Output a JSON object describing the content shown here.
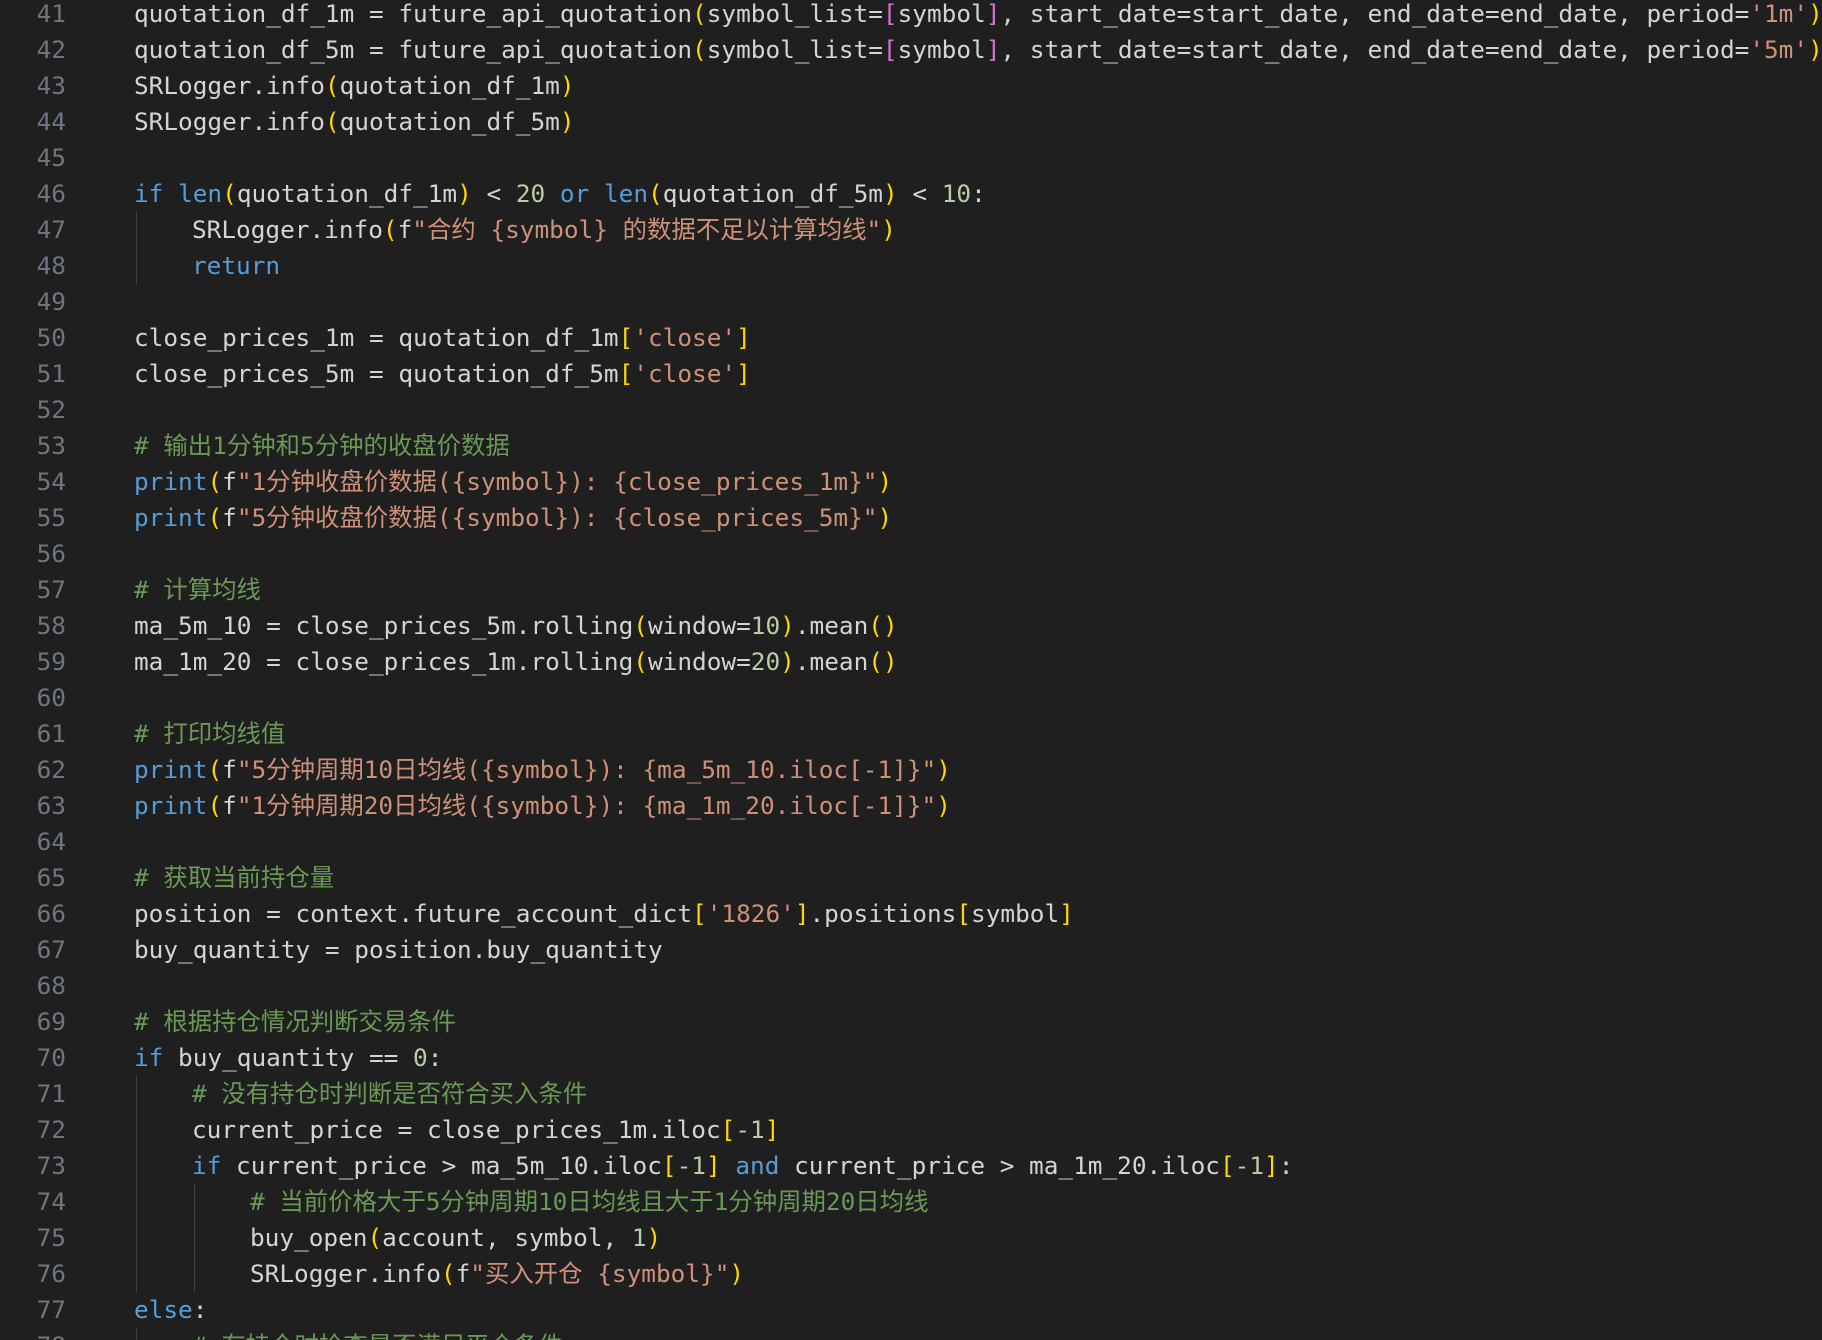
{
  "editor": {
    "language": "python",
    "theme_colors": {
      "background": "#1f1f1f",
      "line_number": "#6e7681",
      "keyword": "#569cd6",
      "string": "#ce9178",
      "number": "#b5cea8",
      "comment": "#6a9955",
      "bracket_level1": "#ffd700",
      "bracket_level2": "#da70d6",
      "plain": "#d4d4d4"
    },
    "lines": [
      {
        "n": "41",
        "indent": 1,
        "tokens": [
          [
            "pl",
            "quotation_df_1m = future_api_quotation"
          ],
          [
            "b1",
            "("
          ],
          [
            "pl",
            "symbol_list="
          ],
          [
            "b2",
            "["
          ],
          [
            "pl",
            "symbol"
          ],
          [
            "b2",
            "]"
          ],
          [
            "pl",
            ", start_date=start_date, end_date=end_date, period="
          ],
          [
            "str",
            "'1m'"
          ],
          [
            "b1",
            ")"
          ]
        ]
      },
      {
        "n": "42",
        "indent": 1,
        "tokens": [
          [
            "pl",
            "quotation_df_5m = future_api_quotation"
          ],
          [
            "b1",
            "("
          ],
          [
            "pl",
            "symbol_list="
          ],
          [
            "b2",
            "["
          ],
          [
            "pl",
            "symbol"
          ],
          [
            "b2",
            "]"
          ],
          [
            "pl",
            ", start_date=start_date, end_date=end_date, period="
          ],
          [
            "str",
            "'5m'"
          ],
          [
            "b1",
            ")"
          ]
        ]
      },
      {
        "n": "43",
        "indent": 1,
        "tokens": [
          [
            "pl",
            "SRLogger.info"
          ],
          [
            "b1",
            "("
          ],
          [
            "pl",
            "quotation_df_1m"
          ],
          [
            "b1",
            ")"
          ]
        ]
      },
      {
        "n": "44",
        "indent": 1,
        "tokens": [
          [
            "pl",
            "SRLogger.info"
          ],
          [
            "b1",
            "("
          ],
          [
            "pl",
            "quotation_df_5m"
          ],
          [
            "b1",
            ")"
          ]
        ]
      },
      {
        "n": "45",
        "indent": 1,
        "tokens": []
      },
      {
        "n": "46",
        "indent": 1,
        "tokens": [
          [
            "kw",
            "if"
          ],
          [
            "pl",
            " "
          ],
          [
            "kw",
            "len"
          ],
          [
            "b1",
            "("
          ],
          [
            "pl",
            "quotation_df_1m"
          ],
          [
            "b1",
            ")"
          ],
          [
            "pl",
            " < "
          ],
          [
            "num",
            "20"
          ],
          [
            "pl",
            " "
          ],
          [
            "kw",
            "or"
          ],
          [
            "pl",
            " "
          ],
          [
            "kw",
            "len"
          ],
          [
            "b1",
            "("
          ],
          [
            "pl",
            "quotation_df_5m"
          ],
          [
            "b1",
            ")"
          ],
          [
            "pl",
            " < "
          ],
          [
            "num",
            "10"
          ],
          [
            "pl",
            ":"
          ]
        ]
      },
      {
        "n": "47",
        "indent": 2,
        "tokens": [
          [
            "pl",
            "SRLogger.info"
          ],
          [
            "b1",
            "("
          ],
          [
            "pl",
            "f"
          ],
          [
            "str",
            "\"合约 {symbol} 的数据不足以计算均线\""
          ],
          [
            "b1",
            ")"
          ]
        ]
      },
      {
        "n": "48",
        "indent": 2,
        "tokens": [
          [
            "kw",
            "return"
          ]
        ]
      },
      {
        "n": "49",
        "indent": 1,
        "tokens": []
      },
      {
        "n": "50",
        "indent": 1,
        "tokens": [
          [
            "pl",
            "close_prices_1m = quotation_df_1m"
          ],
          [
            "b1",
            "["
          ],
          [
            "str",
            "'close'"
          ],
          [
            "b1",
            "]"
          ]
        ]
      },
      {
        "n": "51",
        "indent": 1,
        "tokens": [
          [
            "pl",
            "close_prices_5m = quotation_df_5m"
          ],
          [
            "b1",
            "["
          ],
          [
            "str",
            "'close'"
          ],
          [
            "b1",
            "]"
          ]
        ]
      },
      {
        "n": "52",
        "indent": 1,
        "tokens": []
      },
      {
        "n": "53",
        "indent": 1,
        "tokens": [
          [
            "cm",
            "# 输出1分钟和5分钟的收盘价数据"
          ]
        ]
      },
      {
        "n": "54",
        "indent": 1,
        "tokens": [
          [
            "kw",
            "print"
          ],
          [
            "b1",
            "("
          ],
          [
            "pl",
            "f"
          ],
          [
            "str",
            "\"1分钟收盘价数据({symbol}): {close_prices_1m}\""
          ],
          [
            "b1",
            ")"
          ]
        ]
      },
      {
        "n": "55",
        "indent": 1,
        "tokens": [
          [
            "kw",
            "print"
          ],
          [
            "b1",
            "("
          ],
          [
            "pl",
            "f"
          ],
          [
            "str",
            "\"5分钟收盘价数据({symbol}): {close_prices_5m}\""
          ],
          [
            "b1",
            ")"
          ]
        ]
      },
      {
        "n": "56",
        "indent": 1,
        "tokens": []
      },
      {
        "n": "57",
        "indent": 1,
        "tokens": [
          [
            "cm",
            "# 计算均线"
          ]
        ]
      },
      {
        "n": "58",
        "indent": 1,
        "tokens": [
          [
            "pl",
            "ma_5m_10 = close_prices_5m.rolling"
          ],
          [
            "b1",
            "("
          ],
          [
            "pl",
            "window="
          ],
          [
            "num",
            "10"
          ],
          [
            "b1",
            ")"
          ],
          [
            "pl",
            ".mean"
          ],
          [
            "b1",
            "()"
          ]
        ]
      },
      {
        "n": "59",
        "indent": 1,
        "tokens": [
          [
            "pl",
            "ma_1m_20 = close_prices_1m.rolling"
          ],
          [
            "b1",
            "("
          ],
          [
            "pl",
            "window="
          ],
          [
            "num",
            "20"
          ],
          [
            "b1",
            ")"
          ],
          [
            "pl",
            ".mean"
          ],
          [
            "b1",
            "()"
          ]
        ]
      },
      {
        "n": "60",
        "indent": 1,
        "tokens": []
      },
      {
        "n": "61",
        "indent": 1,
        "tokens": [
          [
            "cm",
            "# 打印均线值"
          ]
        ]
      },
      {
        "n": "62",
        "indent": 1,
        "tokens": [
          [
            "kw",
            "print"
          ],
          [
            "b1",
            "("
          ],
          [
            "pl",
            "f"
          ],
          [
            "str",
            "\"5分钟周期10日均线({symbol}): {ma_5m_10.iloc[-1]}\""
          ],
          [
            "b1",
            ")"
          ]
        ]
      },
      {
        "n": "63",
        "indent": 1,
        "tokens": [
          [
            "kw",
            "print"
          ],
          [
            "b1",
            "("
          ],
          [
            "pl",
            "f"
          ],
          [
            "str",
            "\"1分钟周期20日均线({symbol}): {ma_1m_20.iloc[-1]}\""
          ],
          [
            "b1",
            ")"
          ]
        ]
      },
      {
        "n": "64",
        "indent": 1,
        "tokens": []
      },
      {
        "n": "65",
        "indent": 1,
        "tokens": [
          [
            "cm",
            "# 获取当前持仓量"
          ]
        ]
      },
      {
        "n": "66",
        "indent": 1,
        "tokens": [
          [
            "pl",
            "position = context.future_account_dict"
          ],
          [
            "b1",
            "["
          ],
          [
            "str",
            "'1826'"
          ],
          [
            "b1",
            "]"
          ],
          [
            "pl",
            ".positions"
          ],
          [
            "b1",
            "["
          ],
          [
            "pl",
            "symbol"
          ],
          [
            "b1",
            "]"
          ]
        ]
      },
      {
        "n": "67",
        "indent": 1,
        "tokens": [
          [
            "pl",
            "buy_quantity = position.buy_quantity"
          ]
        ]
      },
      {
        "n": "68",
        "indent": 1,
        "tokens": []
      },
      {
        "n": "69",
        "indent": 1,
        "tokens": [
          [
            "cm",
            "# 根据持仓情况判断交易条件"
          ]
        ]
      },
      {
        "n": "70",
        "indent": 1,
        "tokens": [
          [
            "kw",
            "if"
          ],
          [
            "pl",
            " buy_quantity == "
          ],
          [
            "num",
            "0"
          ],
          [
            "pl",
            ":"
          ]
        ]
      },
      {
        "n": "71",
        "indent": 2,
        "tokens": [
          [
            "cm",
            "# 没有持仓时判断是否符合买入条件"
          ]
        ]
      },
      {
        "n": "72",
        "indent": 2,
        "tokens": [
          [
            "pl",
            "current_price = close_prices_1m.iloc"
          ],
          [
            "b1",
            "["
          ],
          [
            "num",
            "-1"
          ],
          [
            "b1",
            "]"
          ]
        ]
      },
      {
        "n": "73",
        "indent": 2,
        "tokens": [
          [
            "kw",
            "if"
          ],
          [
            "pl",
            " current_price > ma_5m_10.iloc"
          ],
          [
            "b1",
            "["
          ],
          [
            "num",
            "-1"
          ],
          [
            "b1",
            "]"
          ],
          [
            "pl",
            " "
          ],
          [
            "kw",
            "and"
          ],
          [
            "pl",
            " current_price > ma_1m_20.iloc"
          ],
          [
            "b1",
            "["
          ],
          [
            "num",
            "-1"
          ],
          [
            "b1",
            "]"
          ],
          [
            "pl",
            ":"
          ]
        ]
      },
      {
        "n": "74",
        "indent": 3,
        "tokens": [
          [
            "cm",
            "# 当前价格大于5分钟周期10日均线且大于1分钟周期20日均线"
          ]
        ]
      },
      {
        "n": "75",
        "indent": 3,
        "tokens": [
          [
            "pl",
            "buy_open"
          ],
          [
            "b1",
            "("
          ],
          [
            "pl",
            "account, symbol, "
          ],
          [
            "num",
            "1"
          ],
          [
            "b1",
            ")"
          ]
        ]
      },
      {
        "n": "76",
        "indent": 3,
        "tokens": [
          [
            "pl",
            "SRLogger.info"
          ],
          [
            "b1",
            "("
          ],
          [
            "pl",
            "f"
          ],
          [
            "str",
            "\"买入开仓 {symbol}\""
          ],
          [
            "b1",
            ")"
          ]
        ]
      },
      {
        "n": "77",
        "indent": 1,
        "tokens": [
          [
            "kw",
            "else"
          ],
          [
            "pl",
            ":"
          ]
        ]
      },
      {
        "n": "78",
        "indent": 2,
        "tokens": [
          [
            "cm",
            "# 有持仓时检查是否满足平仓条件"
          ]
        ]
      }
    ]
  }
}
